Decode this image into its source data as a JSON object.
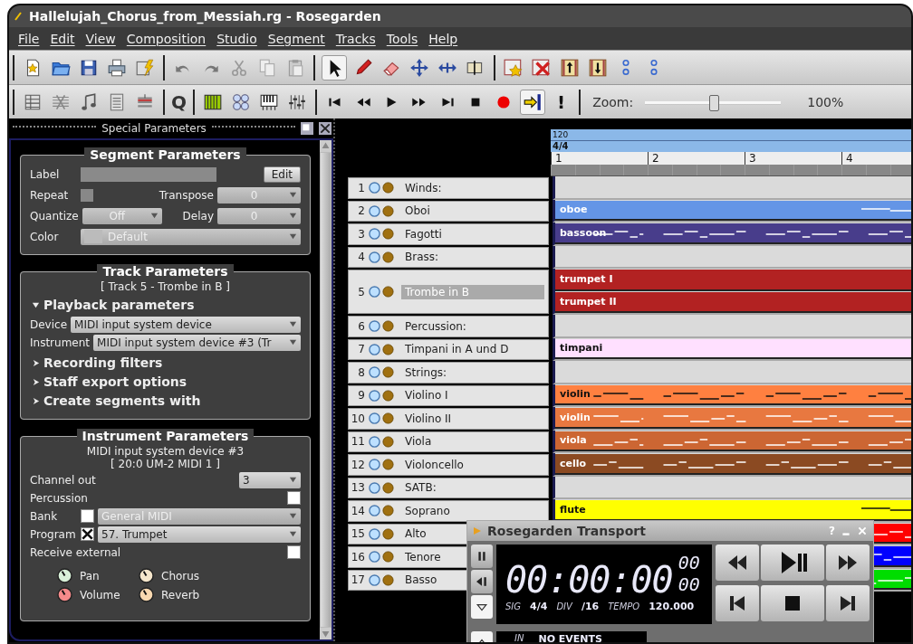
{
  "window": {
    "title": "Hallelujah_Chorus_from_Messiah.rg - Rosegarden"
  },
  "menu": [
    "File",
    "Edit",
    "View",
    "Composition",
    "Studio",
    "Segment",
    "Tracks",
    "Tools",
    "Help"
  ],
  "toolbar": {
    "quantize": "Q",
    "panic": "!",
    "follow_on": true,
    "zoom": {
      "label": "Zoom:",
      "level": 0.5,
      "value": "100%"
    }
  },
  "dock": {
    "title": "Special Parameters"
  },
  "segment_parameters": {
    "title": "Segment Parameters",
    "disabled": true,
    "label": "Label",
    "edit": "Edit",
    "repeat": {
      "label": "Repeat",
      "checked": false
    },
    "transpose": {
      "label": "Transpose",
      "value": "0"
    },
    "quantize": {
      "label": "Quantize",
      "value": "Off"
    },
    "delay": {
      "label": "Delay",
      "value": "0"
    },
    "color": {
      "label": "Color",
      "value": "Default"
    }
  },
  "track_parameters": {
    "title": "Track Parameters",
    "subtitle": "[ Track 5 - Trombe in B ]",
    "sections": [
      {
        "label": "Playback parameters",
        "expanded": true,
        "fields": [
          {
            "label": "Device",
            "value": "MIDI input system device"
          },
          {
            "label": "Instrument",
            "value": "MIDI input system device #3 (Tr"
          }
        ]
      },
      {
        "label": "Recording filters",
        "expanded": false
      },
      {
        "label": "Staff export options",
        "expanded": false
      },
      {
        "label": "Create segments with",
        "expanded": false
      }
    ]
  },
  "instrument_parameters": {
    "title": "Instrument Parameters",
    "device": "MIDI input system device  #3",
    "port": "[ 20:0 UM-2 MIDI 1 ]",
    "channel_out": {
      "label": "Channel out",
      "value": "3"
    },
    "percussion": {
      "label": "Percussion",
      "checked": false
    },
    "bank": {
      "label": "Bank",
      "checked": false,
      "value": "General MIDI"
    },
    "program": {
      "label": "Program",
      "checked": true,
      "value": "57. Trumpet"
    },
    "receive_external": {
      "label": "Receive external",
      "checked": false
    },
    "knobs": [
      {
        "label": "Pan",
        "color": "#d8f0d8"
      },
      {
        "label": "Chorus",
        "color": "#f5e6cc"
      },
      {
        "label": "Volume",
        "color": "#f48a8a"
      },
      {
        "label": "Reverb",
        "color": "#f8d8b0"
      }
    ]
  },
  "ruler": {
    "tempo": "120",
    "time_signature": "4/4",
    "bars": [
      "1",
      "2",
      "3",
      "4"
    ]
  },
  "tracks": [
    {
      "number": "1",
      "name": "Winds:",
      "selected": false
    },
    {
      "number": "2",
      "name": "Oboi",
      "selected": false,
      "segments": [
        {
          "label": "oboe",
          "color": "#6495e6",
          "kind": "sparse"
        }
      ]
    },
    {
      "number": "3",
      "name": "Fagotti",
      "selected": false,
      "segments": [
        {
          "label": "bassoon",
          "color": "#483d8b",
          "kind": "notation"
        }
      ]
    },
    {
      "number": "4",
      "name": "Brass:",
      "selected": false
    },
    {
      "number": "5",
      "name": "Trombe in B",
      "selected": true,
      "segments": [
        {
          "label": "trumpet I",
          "color": "#b22222",
          "kind": "plain"
        },
        {
          "label": "trumpet II",
          "color": "#b22222",
          "kind": "plain"
        }
      ]
    },
    {
      "number": "6",
      "name": "Percussion:",
      "selected": false
    },
    {
      "number": "7",
      "name": "Timpani in A und D",
      "selected": false,
      "segments": [
        {
          "label": "timpani",
          "color": "#ffe0ff",
          "kind": "plain"
        }
      ]
    },
    {
      "number": "8",
      "name": "Strings:",
      "selected": false
    },
    {
      "number": "9",
      "name": "Violino I",
      "selected": false,
      "segments": [
        {
          "label": "violin",
          "color": "#ff8040",
          "kind": "notation"
        }
      ]
    },
    {
      "number": "10",
      "name": "Violino II",
      "selected": false,
      "segments": [
        {
          "label": "violin",
          "color": "#e87840",
          "kind": "notation"
        }
      ]
    },
    {
      "number": "11",
      "name": "Viola",
      "selected": false,
      "segments": [
        {
          "label": "viola",
          "color": "#cc6633",
          "kind": "notation"
        }
      ]
    },
    {
      "number": "12",
      "name": "Violoncello",
      "selected": false,
      "segments": [
        {
          "label": "cello",
          "color": "#8b4a22",
          "kind": "notation"
        }
      ]
    },
    {
      "number": "13",
      "name": "SATB:",
      "selected": false
    },
    {
      "number": "14",
      "name": "Soprano",
      "selected": false,
      "segments": [
        {
          "label": "flute",
          "color": "#ffff00",
          "kind": "sparse"
        }
      ]
    },
    {
      "number": "15",
      "name": "Alto",
      "selected": false,
      "segments": [
        {
          "color": "#ff0000",
          "kind": "notation"
        }
      ]
    },
    {
      "number": "16",
      "name": "Tenore",
      "selected": false,
      "segments": [
        {
          "color": "#0000ff",
          "kind": "notation"
        }
      ]
    },
    {
      "number": "17",
      "name": "Basso",
      "selected": false,
      "segments": [
        {
          "color": "#00dd00",
          "kind": "notation"
        }
      ]
    }
  ],
  "transport": {
    "title": "Rosegarden Transport",
    "help": "?",
    "time": "00:00:00",
    "subtime": "00 00",
    "sig_label": "SIG",
    "sig": "4/4",
    "div_label": "DIV",
    "div": "/16",
    "tempo_label": "TEMPO",
    "tempo": "120.000",
    "in_label": "IN",
    "in_value": "NO EVENTS"
  }
}
